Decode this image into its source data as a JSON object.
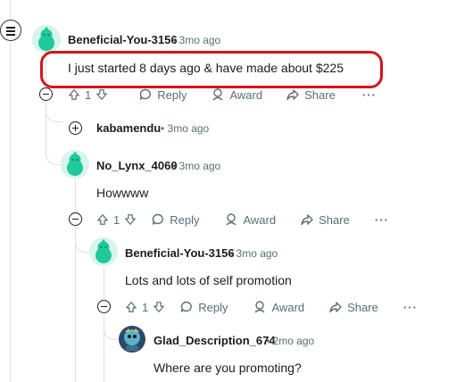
{
  "comments": [
    {
      "username": "Beneficial-You-3156",
      "time": "• 3mo ago",
      "body": "I just started 8 days ago & have made about $225",
      "votes": "1",
      "actions": {
        "reply": "Reply",
        "award": "Award",
        "share": "Share",
        "more": "···"
      }
    },
    {
      "username": "kabamendu",
      "time": "• 3mo ago"
    },
    {
      "username": "No_Lynx_4060",
      "time": "• 3mo ago",
      "body": "Howwww",
      "votes": "1",
      "actions": {
        "reply": "Reply",
        "award": "Award",
        "share": "Share",
        "more": "···"
      }
    },
    {
      "username": "Beneficial-You-3156",
      "time": "• 3mo ago",
      "body": "Lots and lots of self promotion",
      "votes": "1",
      "actions": {
        "reply": "Reply",
        "award": "Award",
        "share": "Share",
        "more": "···"
      }
    },
    {
      "username": "Glad_Description_674",
      "time": "• 2mo ago",
      "body": "Where are you promoting?"
    }
  ],
  "colors": {
    "highlight_border": "#d4141c",
    "avatar_green": "#1fc99a",
    "meta_gray": "#576f76"
  },
  "icons": [
    "menu-icon",
    "collapse-icon",
    "expand-icon",
    "upvote-icon",
    "downvote-icon",
    "reply-icon",
    "award-icon",
    "share-icon",
    "more-icon"
  ]
}
